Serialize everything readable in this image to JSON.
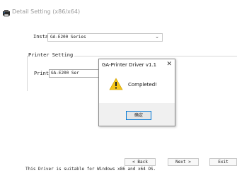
{
  "window": {
    "title": "Detail Setting (x86/x64)",
    "icon": "printer-app-icon"
  },
  "install_module": {
    "label": "Install Module",
    "value": "GA-E200 Series",
    "icon": "chevron-down-icon"
  },
  "printer_setting": {
    "group_label": "Printer Setting",
    "name_label": "Printer Name",
    "name_value": "GA-E200 Ser"
  },
  "buttons": {
    "back": "< Back",
    "next": "Next >",
    "exit": "Exit"
  },
  "footer": {
    "text": "This Driver is suitable for Windows x86 and x64 OS."
  },
  "dialog": {
    "title": "GA-Printer Driver v1.1",
    "close_icon": "close-icon",
    "message": "Completed!",
    "icon": "warning-icon",
    "ok_label": "确定"
  },
  "colors": {
    "accent": "#0078d7",
    "warning": "#f5c518",
    "title_text": "#9a9a9a"
  }
}
